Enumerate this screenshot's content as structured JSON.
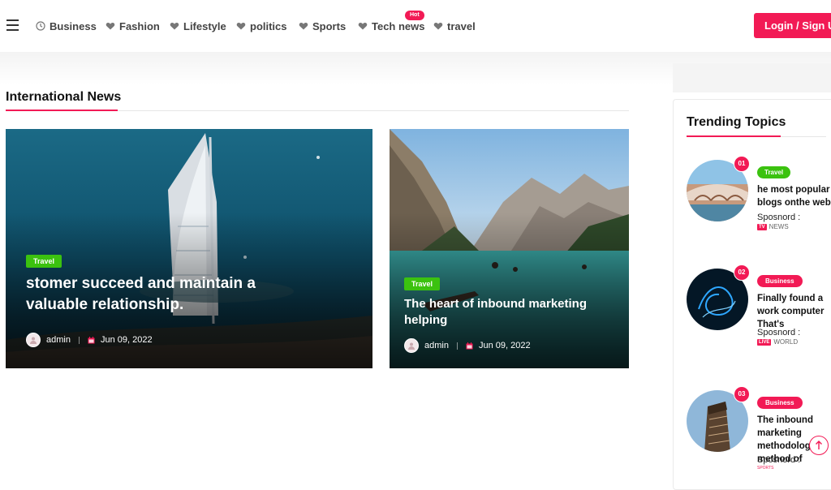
{
  "nav": {
    "items": [
      {
        "label": "Business",
        "icon": "clock-icon"
      },
      {
        "label": "Fashion",
        "icon": "heart-icon"
      },
      {
        "label": "Lifestyle",
        "icon": "heart-icon"
      },
      {
        "label": "politics",
        "icon": "heart-icon"
      },
      {
        "label": "Sports",
        "icon": "heart-icon"
      },
      {
        "label": "Tech news",
        "icon": "heart-icon",
        "badge": "Hot"
      },
      {
        "label": "travel",
        "icon": "heart-icon"
      }
    ],
    "login_label": "Login / Sign Up"
  },
  "section": {
    "title": "International News"
  },
  "cards": [
    {
      "tag": "Travel",
      "title": "stomer succeed and maintain a valuable relationship.",
      "author": "admin",
      "date": "Jun 09, 2022"
    },
    {
      "tag": "Travel",
      "title": "The heart of inbound marketing helping",
      "author": "admin",
      "date": "Jun 09, 2022"
    }
  ],
  "sidebar": {
    "title": "Trending Topics",
    "items": [
      {
        "num": "01",
        "category": "Travel",
        "title": "he most popular blogs onthe web",
        "sponsored": "Sposnord :",
        "sponsor_badge": "TV",
        "sponsor_name": "NEWS"
      },
      {
        "num": "02",
        "category": "Business",
        "title": "Finally found a work computer That's",
        "sponsored": "Sposnord :",
        "sponsor_badge": "LIVE",
        "sponsor_name": "WORLD"
      },
      {
        "num": "03",
        "category": "Business",
        "title": "The inbound marketing methodology method of",
        "sponsored": "Sposnord :",
        "sponsor_badge": "",
        "sponsor_name": "SPORTS"
      }
    ]
  },
  "colors": {
    "accent": "#f21a55",
    "tag_green": "#3bc20f"
  }
}
